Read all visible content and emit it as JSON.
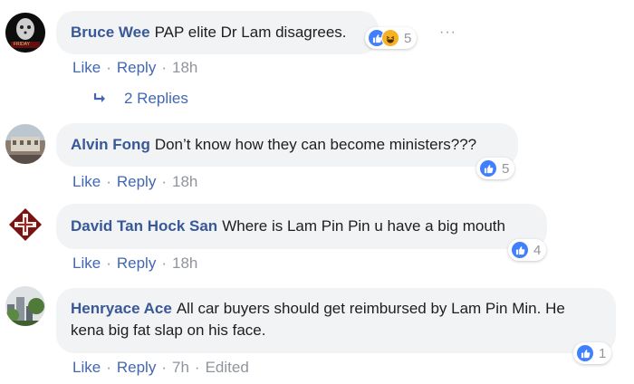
{
  "comments": [
    {
      "author": "Bruce Wee",
      "text": "PAP elite Dr Lam disagrees.",
      "like_label": "Like",
      "reply_label": "Reply",
      "time": "18h",
      "reaction_count": "5",
      "reaction_icons": [
        "like-icon",
        "haha-icon"
      ],
      "avatar_text": "FRIDAY",
      "replies_label": "2 Replies"
    },
    {
      "author": "Alvin Fong",
      "text": "Don’t know how they can become ministers???",
      "like_label": "Like",
      "reply_label": "Reply",
      "time": "18h",
      "reaction_count": "5",
      "reaction_icons": [
        "like-icon"
      ]
    },
    {
      "author": "David Tan Hock San",
      "text": "Where is Lam Pin Pin u have a big mouth",
      "like_label": "Like",
      "reply_label": "Reply",
      "time": "18h",
      "reaction_count": "4",
      "reaction_icons": [
        "like-icon"
      ]
    },
    {
      "author": "Henryace Ace",
      "text": "All car buyers should get reimbursed by Lam Pin Min. He kena big fat slap on his face.",
      "like_label": "Like",
      "reply_label": "Reply",
      "time": "7h",
      "edited": "Edited",
      "reaction_count": "1",
      "reaction_icons": [
        "like-icon"
      ]
    }
  ],
  "more_options": "···",
  "separator": "·",
  "colors": {
    "name": "#385898",
    "link": "#4267b2",
    "muted": "#90949c",
    "bubble": "#f2f3f5",
    "like": "#4080ff",
    "haha": "#f7b125"
  }
}
